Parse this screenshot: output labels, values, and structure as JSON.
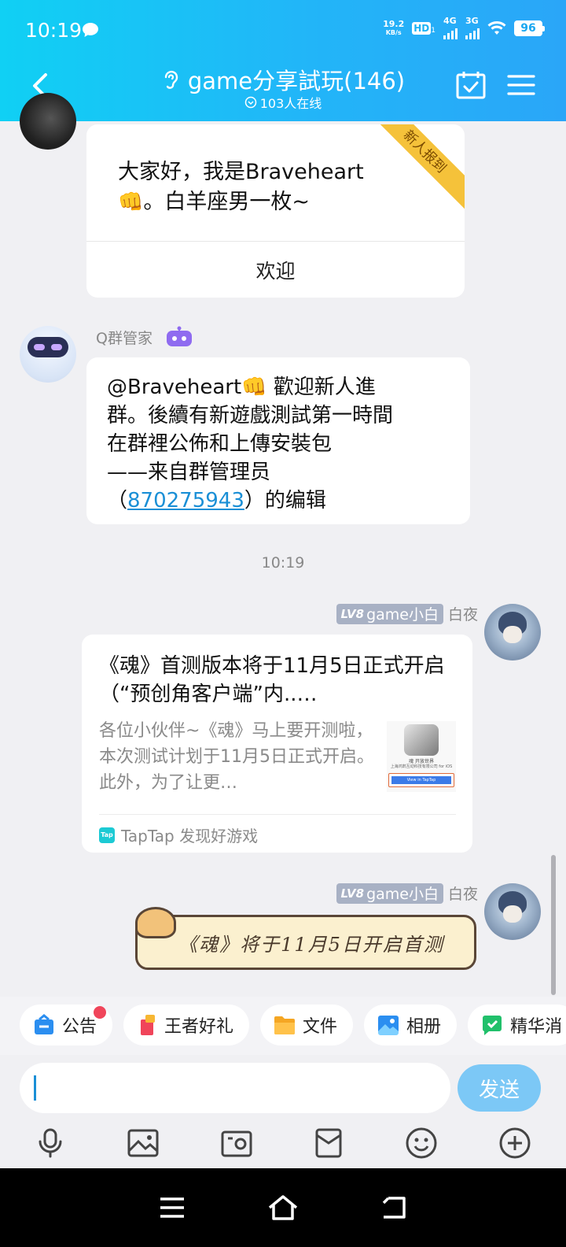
{
  "status_bar": {
    "time": "10:19",
    "net_speed_value": "19.2",
    "net_speed_unit": "KB/s",
    "hd": "HD",
    "sim1": "1",
    "net1": "4G",
    "net2": "3G",
    "battery": "96"
  },
  "header": {
    "title": "game分享試玩(146)",
    "online": "103人在线"
  },
  "welcome_card": {
    "text_line1": "大家好，我是Braveheart",
    "text_line2": "。白羊座男一枚~",
    "ribbon": "新人报到",
    "action": "欢迎"
  },
  "bot_message": {
    "sender": "Q群管家",
    "lines": [
      "@Braveheart👊 歡迎新人進",
      "群。後續有新遊戲測試第一時間",
      "在群裡公佈和上傳安裝包",
      "——来自群管理员"
    ],
    "paren_open": "（",
    "admin_id": "870275943",
    "suffix": "）的编辑"
  },
  "timestamp": "10:19",
  "share_message": {
    "level": "LV8",
    "title_tag": "game小白",
    "sender": "白夜",
    "title": "《魂》首测版本将于11月5日正式开启（“预创角客户端”内..…",
    "desc": "各位小伙伴~《魂》马上要开测啦，本次测试计划于11月5日正式开启。此外，为了让更…",
    "thumb_caption": "魂 开放世界",
    "thumb_sub": "上海鸿鹄互动科技有限公司 for iOS",
    "thumb_btn": "View in TapTap",
    "source_logo": "Tap",
    "source": "TapTap 发现好游戏"
  },
  "sticker_message": {
    "level": "LV8",
    "title_tag": "game小白",
    "sender": "白夜",
    "text": "《魂》将于11月5日开启首测"
  },
  "chips": [
    {
      "label": "公告",
      "icon": "announcement-icon"
    },
    {
      "label": "王者好礼",
      "icon": "gift-icon"
    },
    {
      "label": "文件",
      "icon": "folder-icon"
    },
    {
      "label": "相册",
      "icon": "album-icon"
    },
    {
      "label": "精华消",
      "icon": "essence-icon"
    }
  ],
  "input": {
    "placeholder": "",
    "send_label": "发送"
  },
  "colors": {
    "header_start": "#10d0f4",
    "header_end": "#2aa6f8",
    "link": "#1a8fd6",
    "send": "#7cc8f6",
    "ribbon": "#f5c23a"
  }
}
